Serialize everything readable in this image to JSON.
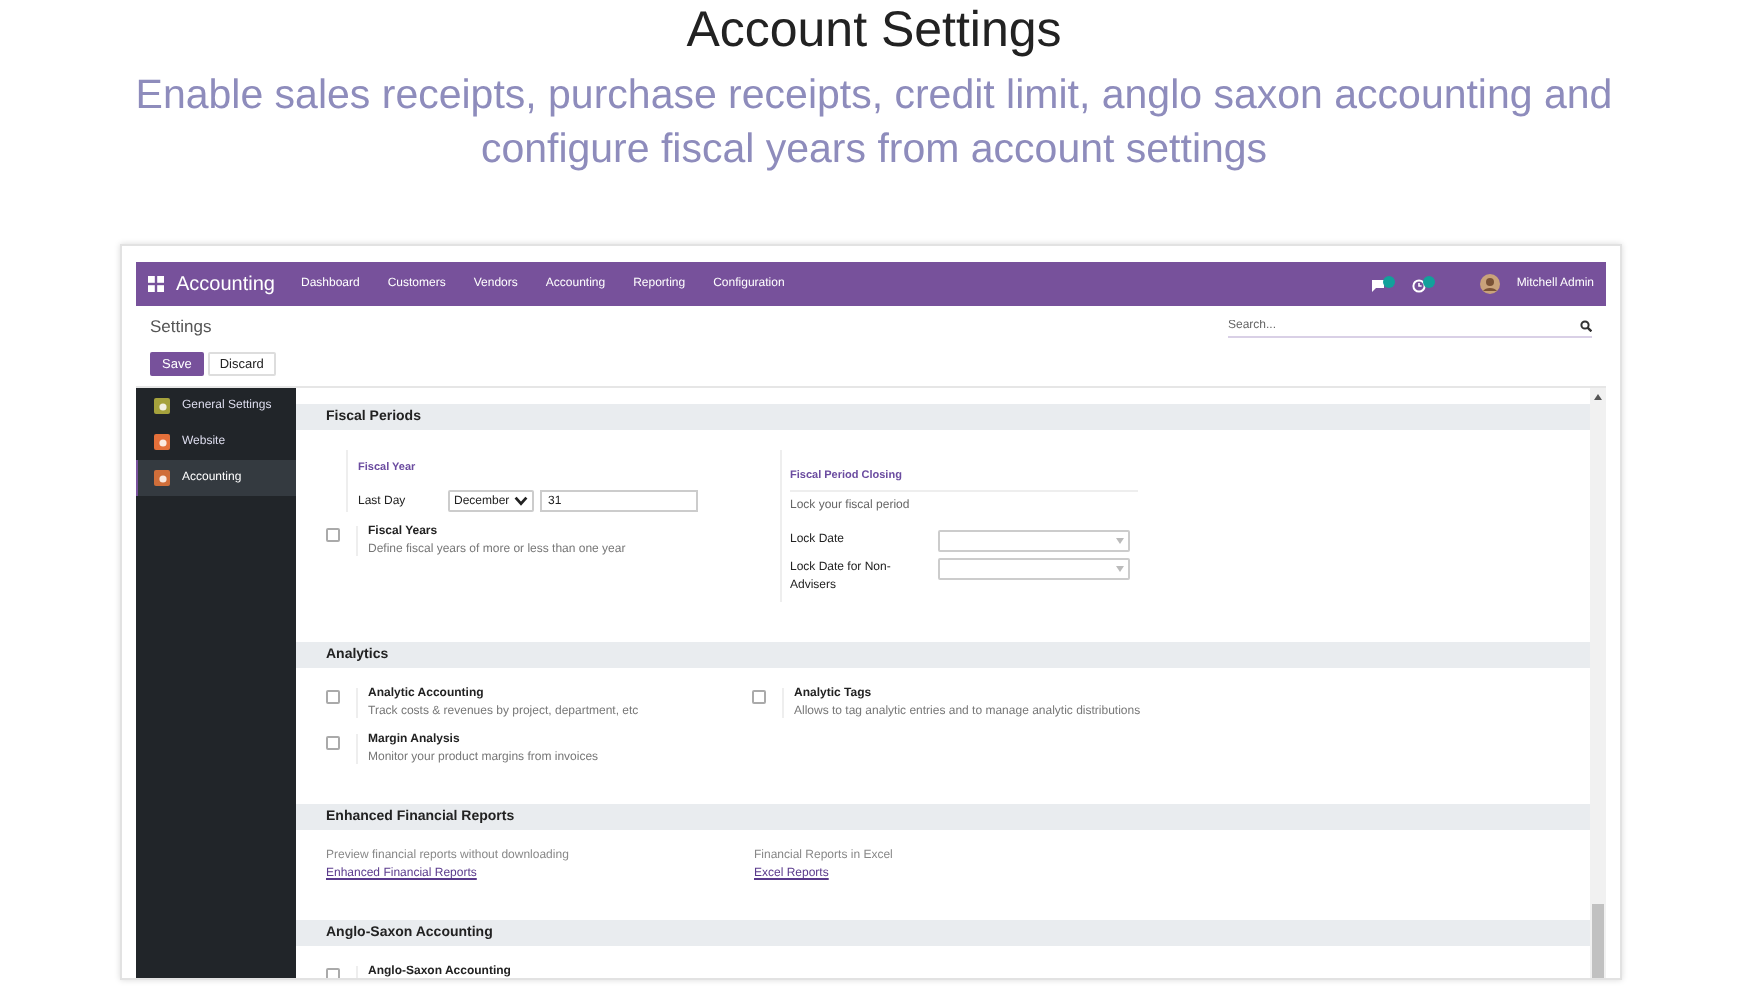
{
  "page": {
    "title": "Account Settings",
    "subtitle": "Enable sales receipts, purchase receipts, credit limit, anglo saxon accounting and configure fiscal years from account settings"
  },
  "navbar": {
    "app": "Accounting",
    "menu": [
      "Dashboard",
      "Customers",
      "Vendors",
      "Accounting",
      "Reporting",
      "Configuration"
    ],
    "user": "Mitchell Admin"
  },
  "control_panel": {
    "breadcrumb": "Settings",
    "search": {
      "placeholder": "Search..."
    },
    "buttons": [
      {
        "label": "Save",
        "kind": "primary"
      },
      {
        "label": "Discard",
        "kind": "secondary"
      }
    ]
  },
  "sidebar": {
    "items": [
      {
        "label": "General Settings",
        "selected": false,
        "color": "#a5a23c"
      },
      {
        "label": "Website",
        "selected": false,
        "color": "#e4703a"
      },
      {
        "label": "Accounting",
        "selected": true,
        "color": "#cf6e3a"
      }
    ]
  },
  "sections": [
    {
      "title": "Fiscal Periods",
      "kind": "fiscal",
      "fiscal_year": {
        "heading": "Fiscal Year",
        "label": "Last Day",
        "month": "December",
        "day": "31"
      },
      "closing": {
        "heading": "Fiscal Period Closing",
        "description": "Lock your fiscal period",
        "fields": [
          {
            "label": "Lock Date"
          },
          {
            "label": "Lock Date for Non-Advisers"
          }
        ]
      },
      "settings": [
        {
          "title": "Fiscal Years",
          "description": "Define fiscal years of more or less than one year",
          "checked": false
        }
      ]
    },
    {
      "title": "Analytics",
      "kind": "settings",
      "settings": [
        {
          "title": "Analytic Accounting",
          "description": "Track costs & revenues by project, department, etc",
          "checked": false
        },
        {
          "title": "Analytic Tags",
          "description": "Allows to tag analytic entries and to manage analytic distributions",
          "checked": false
        },
        {
          "title": "Margin Analysis",
          "description": "Monitor your product margins from invoices",
          "checked": false
        }
      ]
    },
    {
      "title": "Enhanced Financial Reports",
      "kind": "links",
      "links": [
        {
          "description": "Preview financial reports without downloading",
          "link": "Enhanced Financial Reports"
        },
        {
          "description": "Financial Reports in Excel",
          "link": "Excel Reports"
        }
      ]
    },
    {
      "title": "Anglo-Saxon Accounting",
      "kind": "settings",
      "settings": [
        {
          "title": "Anglo-Saxon Accounting",
          "checked": false
        }
      ]
    }
  ]
}
